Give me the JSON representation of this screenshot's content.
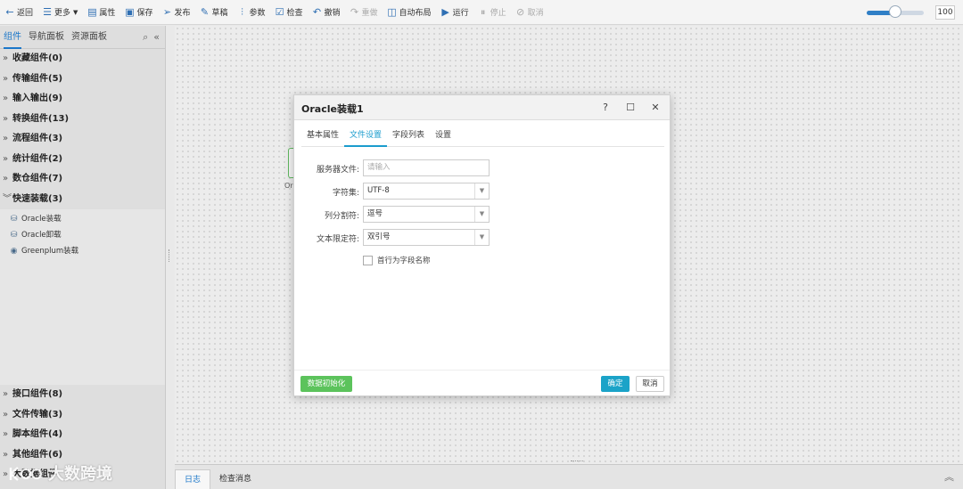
{
  "toolbar": {
    "back": "返回",
    "more": "更多",
    "properties": "属性",
    "save": "保存",
    "publish": "发布",
    "draft": "草稿",
    "params": "参数",
    "check": "检查",
    "undo": "撤销",
    "redo": "重做",
    "auto_layout": "自动布局",
    "run": "运行",
    "pause": "停止",
    "cancel": "取消",
    "zoom_value": "100",
    "zoom_fraction": 0.5
  },
  "left_panel": {
    "tabs": [
      "组件",
      "导航面板",
      "资源面板"
    ],
    "groups_top": [
      "收藏组件(0)",
      "传输组件(5)",
      "输入输出(9)",
      "转换组件(13)",
      "流程组件(3)",
      "统计组件(2)",
      "数仓组件(7)"
    ],
    "expanded_group": "快速装载(3)",
    "sub_items": [
      "Oracle装载",
      "Oracle卸载",
      "Greenplum装载"
    ],
    "groups_bottom": [
      "接口组件(8)",
      "文件传输(3)",
      "脚本组件(4)",
      "其他组件(6)",
      "大数据组件"
    ]
  },
  "canvas": {
    "node_label": "Or"
  },
  "bottom_bar": {
    "tabs": [
      "日志",
      "检查消息"
    ]
  },
  "watermark": {
    "text": "大数跨境"
  },
  "dialog": {
    "title": "Oracle装载1",
    "tabs": [
      "基本属性",
      "文件设置",
      "字段列表",
      "设置"
    ],
    "active_tab": "文件设置",
    "fields": {
      "server_file_label": "服务器文件:",
      "server_file_placeholder": "请输入",
      "charset_label": "字符集:",
      "charset_value": "UTF-8",
      "delimiter_label": "列分割符:",
      "delimiter_value": "逗号",
      "qualifier_label": "文本限定符:",
      "qualifier_value": "双引号",
      "first_row_label": "首行为字段名称"
    },
    "buttons": {
      "init": "数据初始化",
      "ok": "确定",
      "cancel": "取消"
    }
  }
}
